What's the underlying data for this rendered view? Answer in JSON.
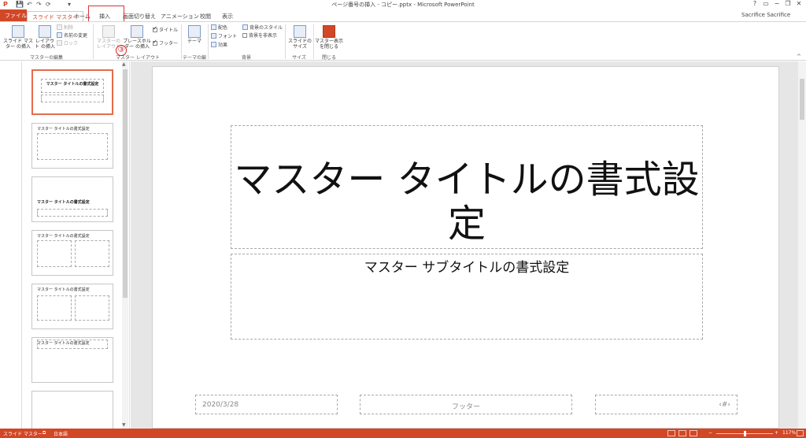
{
  "window": {
    "title": "ページ番号の挿入 - コピー.pptx - Microsoft PowerPoint",
    "user": "Sacrifice Sacrifice",
    "controls": [
      "?",
      "▭",
      "−",
      "❐",
      "✕"
    ]
  },
  "quick_access": [
    "P",
    "💾",
    "↶",
    "↷",
    "⟳",
    "▾"
  ],
  "tabs": [
    "ファイル",
    "スライド マスター",
    "ホーム",
    "挿入",
    "画面切り替え",
    "アニメーション",
    "校閲",
    "表示"
  ],
  "ribbon": {
    "insert_slide_master": "スライド マスター の挿入",
    "insert_layout": "レイアウト の挿入",
    "delete": "削除",
    "rename": "名前の変更",
    "lock": "ロック",
    "group_master_edit": "マスターの編集",
    "master_layout": "マスターの レイアウト",
    "insert_placeholder": "プレースホルダー の挿入",
    "title_check": "タイトル",
    "footer_check": "フッター",
    "group_master_layout": "マスター レイアウト",
    "theme": "テーマ",
    "group_theme_edit": "テーマの編集",
    "colors": "配色",
    "fonts": "フォント",
    "effects": "効果",
    "bg_styles": "背景のスタイル",
    "hide_bg": "背景を非表示",
    "group_background": "背景",
    "slide_size": "スライドの サイズ",
    "group_size": "サイズ",
    "close_master": "マスター表示 を閉じる",
    "group_close": "閉じる",
    "annotation_step": "③"
  },
  "thumbnails": [
    {
      "title": "マスター タイトルの書式設定",
      "selected": true
    },
    {
      "title": "マスター タイトルの書式設定",
      "selected": false
    },
    {
      "title": "マスター タイトルの書式設定",
      "selected": false
    },
    {
      "title": "マスター タイトルの書式設定",
      "selected": false
    },
    {
      "title": "マスター タイトルの書式設定",
      "selected": false
    },
    {
      "title": "マスター タイトルの書式設定",
      "selected": false
    }
  ],
  "slide": {
    "title_line1": "マスター タイトルの書式設",
    "title_line2": "定",
    "subtitle": "マスター サブタイトルの書式設定",
    "date": "2020/3/28",
    "footer": "フッター",
    "page_number": "‹#›"
  },
  "status": {
    "view": "スライド マスター",
    "language": "日本語",
    "zoom": "117%",
    "zoom_level": 0.5
  },
  "colors": {
    "accent": "#d24726",
    "highlight": "#e03030"
  }
}
